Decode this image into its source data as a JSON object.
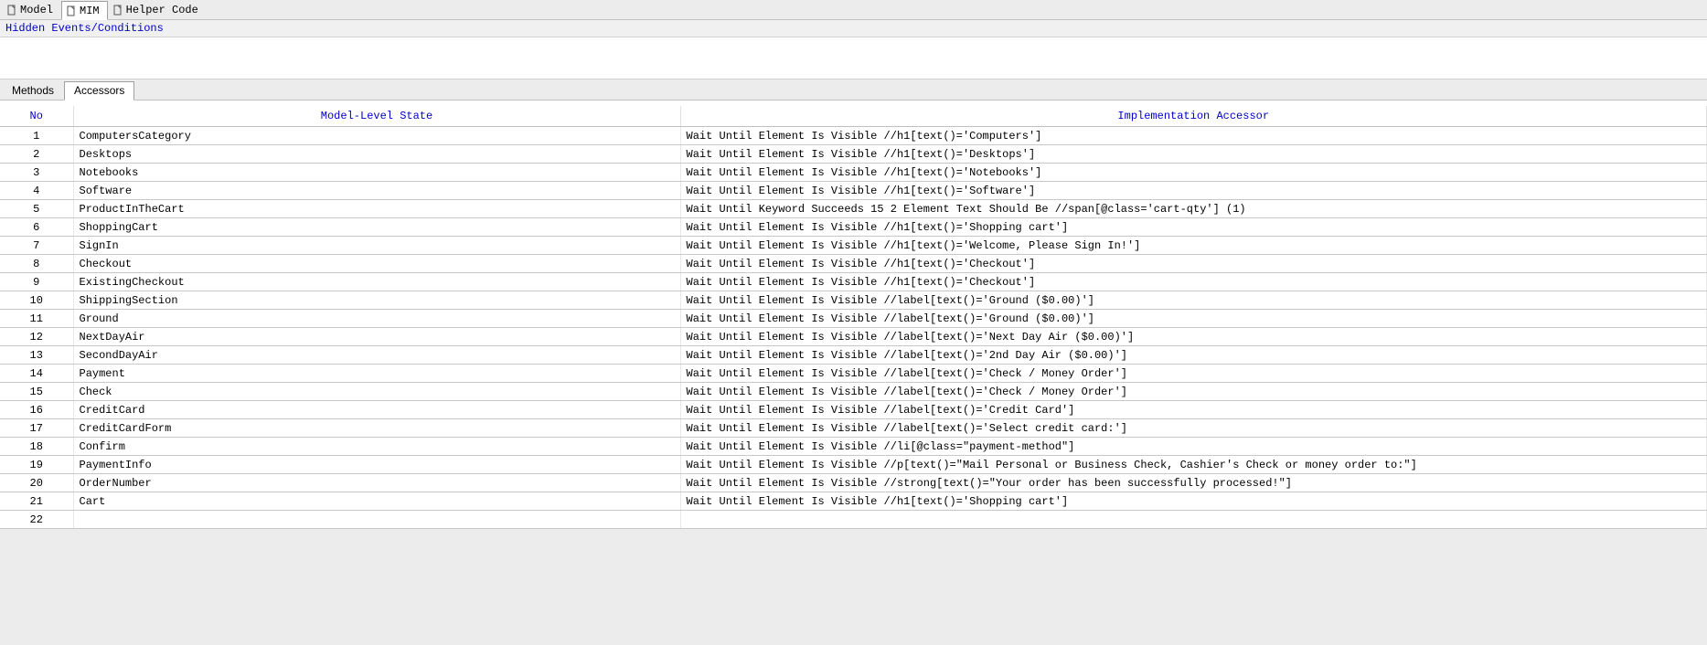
{
  "top_tabs": [
    {
      "label": "Model",
      "active": false
    },
    {
      "label": "MIM",
      "active": true
    },
    {
      "label": "Helper Code",
      "active": false
    }
  ],
  "hidden_events_label": "Hidden Events/Conditions",
  "sub_tabs": [
    {
      "label": "Methods",
      "active": false
    },
    {
      "label": "Accessors",
      "active": true
    }
  ],
  "table": {
    "headers": {
      "no": "No",
      "state": "Model-Level State",
      "impl": "Implementation Accessor"
    },
    "rows": [
      {
        "no": "1",
        "state": "ComputersCategory",
        "impl": "Wait Until Element Is Visible   //h1[text()='Computers']"
      },
      {
        "no": "2",
        "state": "Desktops",
        "impl": "Wait Until Element Is Visible   //h1[text()='Desktops']"
      },
      {
        "no": "3",
        "state": "Notebooks",
        "impl": "Wait Until Element Is Visible   //h1[text()='Notebooks']"
      },
      {
        "no": "4",
        "state": "Software",
        "impl": "Wait Until Element Is Visible   //h1[text()='Software']"
      },
      {
        "no": "5",
        "state": "ProductInTheCart",
        "impl": "Wait Until Keyword Succeeds   15    2    Element Text Should Be     //span[@class='cart-qty']   (1)"
      },
      {
        "no": "6",
        "state": "ShoppingCart",
        "impl": "Wait Until Element Is Visible   //h1[text()='Shopping cart']"
      },
      {
        "no": "7",
        "state": "SignIn",
        "impl": "Wait Until Element Is Visible   //h1[text()='Welcome, Please Sign In!']"
      },
      {
        "no": "8",
        "state": "Checkout",
        "impl": "Wait Until Element Is Visible   //h1[text()='Checkout']"
      },
      {
        "no": "9",
        "state": "ExistingCheckout",
        "impl": "Wait Until Element Is Visible   //h1[text()='Checkout']"
      },
      {
        "no": "10",
        "state": "ShippingSection",
        "impl": "Wait Until Element Is Visible   //label[text()='Ground ($0.00)']"
      },
      {
        "no": "11",
        "state": "Ground",
        "impl": "Wait Until Element Is Visible   //label[text()='Ground ($0.00)']"
      },
      {
        "no": "12",
        "state": "NextDayAir",
        "impl": "Wait Until Element Is Visible   //label[text()='Next Day Air ($0.00)']"
      },
      {
        "no": "13",
        "state": "SecondDayAir",
        "impl": "Wait Until Element Is Visible   //label[text()='2nd Day Air ($0.00)']"
      },
      {
        "no": "14",
        "state": "Payment",
        "impl": "Wait Until Element Is Visible   //label[text()='Check / Money Order']"
      },
      {
        "no": "15",
        "state": "Check",
        "impl": "Wait Until Element Is Visible   //label[text()='Check / Money Order']"
      },
      {
        "no": "16",
        "state": "CreditCard",
        "impl": "Wait Until Element Is Visible   //label[text()='Credit Card']"
      },
      {
        "no": "17",
        "state": "CreditCardForm",
        "impl": "Wait Until Element Is Visible   //label[text()='Select credit card:']"
      },
      {
        "no": "18",
        "state": "Confirm",
        "impl": "Wait Until Element Is Visible   //li[@class=\"payment-method\"]"
      },
      {
        "no": "19",
        "state": "PaymentInfo",
        "impl": "Wait Until Element Is Visible    //p[text()=\"Mail Personal or Business Check, Cashier's Check or money order to:\"]"
      },
      {
        "no": "20",
        "state": "OrderNumber",
        "impl": "Wait Until Element Is Visible    //strong[text()=\"Your order has been successfully processed!\"]"
      },
      {
        "no": "21",
        "state": "Cart",
        "impl": "Wait Until Element Is Visible   //h1[text()='Shopping cart']"
      },
      {
        "no": "22",
        "state": "",
        "impl": ""
      }
    ]
  }
}
